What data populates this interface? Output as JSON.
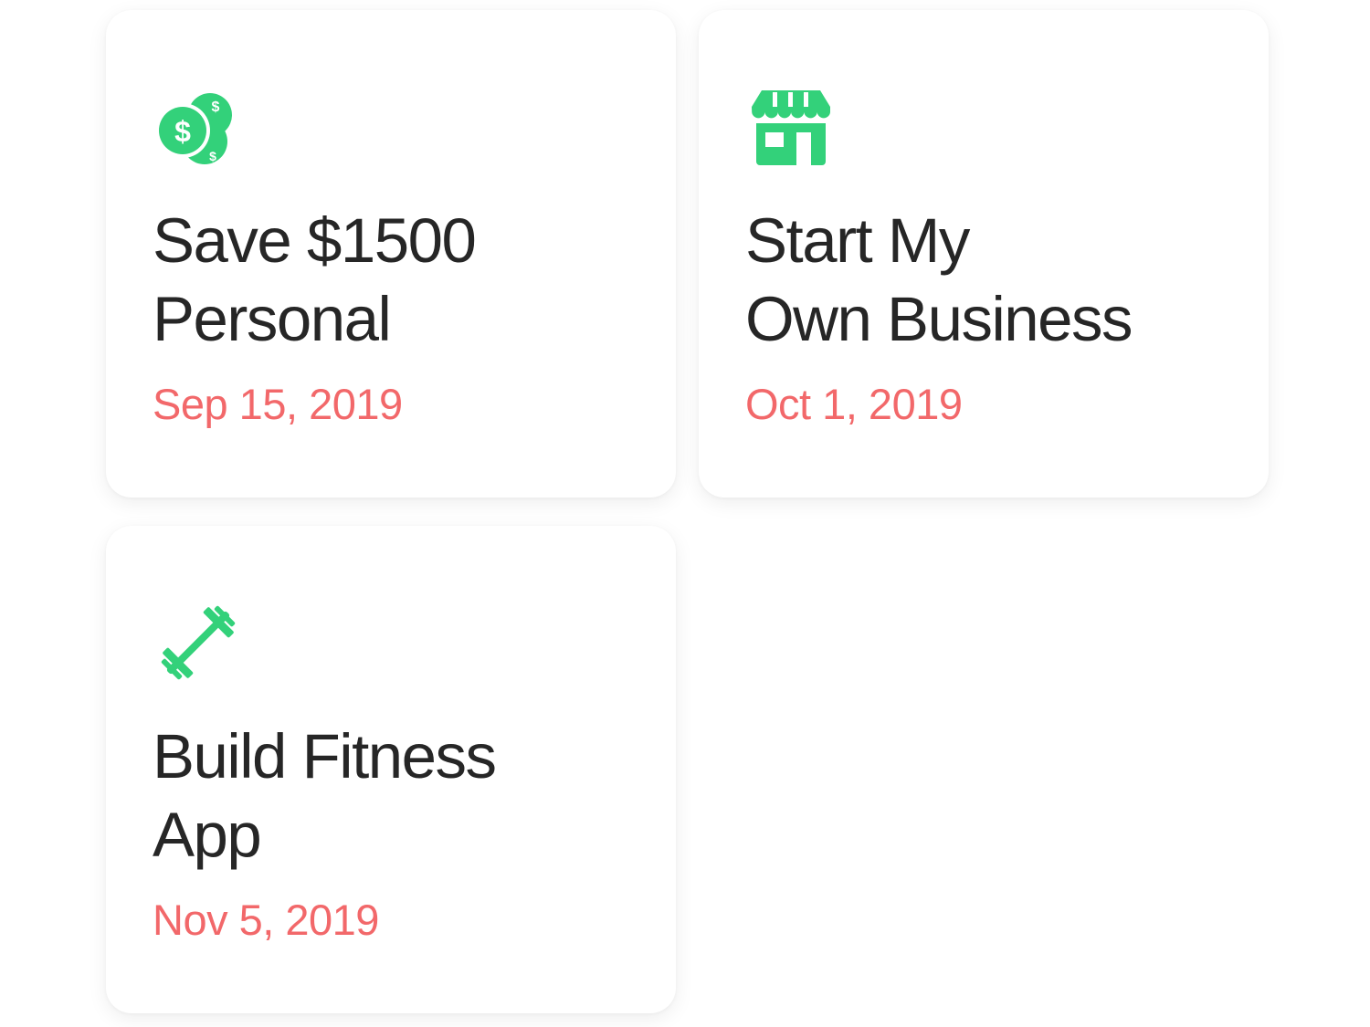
{
  "accent_color": "#33d17a",
  "date_color": "#f2686a",
  "goals": [
    {
      "icon": "money-coins-icon",
      "title_line1": "Save $1500",
      "title_line2": "Personal",
      "date": "Sep 15, 2019"
    },
    {
      "icon": "storefront-icon",
      "title_line1": "Start My",
      "title_line2": "Own Business",
      "date": "Oct 1, 2019"
    },
    {
      "icon": "dumbbell-icon",
      "title_line1": "Build Fitness",
      "title_line2": "App",
      "date": "Nov 5, 2019"
    }
  ]
}
